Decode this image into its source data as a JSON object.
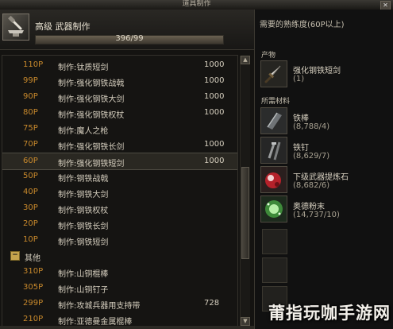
{
  "window": {
    "title": "道具制作"
  },
  "skill": {
    "level_label": "高级 武器制作",
    "progress_text": "396/99",
    "progress_fraction": 1.0,
    "icon": "anvil-icon"
  },
  "requirement": {
    "text": "需要的熟练度(60P以上)"
  },
  "list": {
    "rows": [
      {
        "req": "110P",
        "name": "制作:钛质短剑",
        "price": "1000"
      },
      {
        "req": "99P",
        "name": "制作:强化钢铁战戟",
        "price": "1000"
      },
      {
        "req": "90P",
        "name": "制作:强化钢铁大剑",
        "price": "1000"
      },
      {
        "req": "80P",
        "name": "制作:强化钢铁权杖",
        "price": "1000"
      },
      {
        "req": "75P",
        "name": "制作:魔人之枪",
        "price": ""
      },
      {
        "req": "70P",
        "name": "制作:强化钢铁长剑",
        "price": "1000"
      },
      {
        "req": "60P",
        "name": "制作:强化钢铁短剑",
        "price": "1000",
        "selected": true
      },
      {
        "req": "50P",
        "name": "制作:钢铁战戟",
        "price": ""
      },
      {
        "req": "40P",
        "name": "制作:钢铁大剑",
        "price": ""
      },
      {
        "req": "30P",
        "name": "制作:钢铁权杖",
        "price": ""
      },
      {
        "req": "20P",
        "name": "制作:钢铁长剑",
        "price": ""
      },
      {
        "req": "10P",
        "name": "制作:钢铁短剑",
        "price": ""
      },
      {
        "category": true,
        "toggle": "−",
        "name": "其他"
      },
      {
        "req": "310P",
        "name": "制作:山铜棍棒",
        "price": ""
      },
      {
        "req": "305P",
        "name": "制作:山铜钉子",
        "price": ""
      },
      {
        "req": "299P",
        "name": "制作:攻城兵器用支持带",
        "price": "728"
      },
      {
        "req": "210P",
        "name": "制作:亚德曼金属棍棒",
        "price": ""
      }
    ]
  },
  "output": {
    "label": "产物",
    "item": {
      "name": "强化钢铁短剑",
      "count": "(1)",
      "icon": "dagger-icon"
    }
  },
  "materials": {
    "label": "所需材料",
    "items": [
      {
        "name": "铁棒",
        "count": "(8,788/4)",
        "icon": "iron-bar-icon"
      },
      {
        "name": "铁钉",
        "count": "(8,629/7)",
        "icon": "iron-nail-icon"
      },
      {
        "name": "下级武器提炼石",
        "count": "(8,682/6)",
        "icon": "red-gem-icon"
      },
      {
        "name": "奥德粉末",
        "count": "(14,737/10)",
        "icon": "green-powder-icon"
      }
    ]
  },
  "watermark": "莆指玩咖手游网"
}
